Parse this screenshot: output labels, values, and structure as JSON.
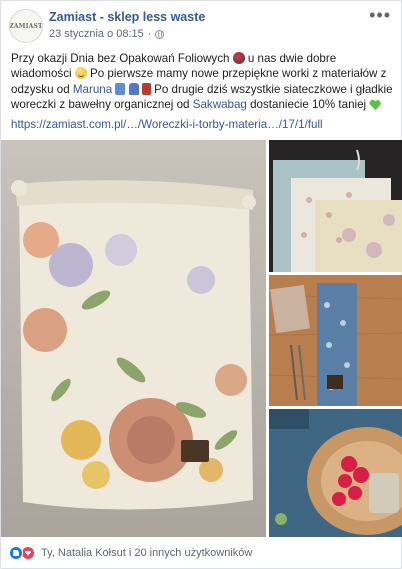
{
  "post": {
    "author": "Zamiast - sklep less waste",
    "avatar_text": "ZAMIAST",
    "date": "23 stycznia o 08:15",
    "separator": "·",
    "more_label": "•••",
    "text_part1": "Przy okazji Dnia bez Opakowań Foliowych ",
    "text_part2": " u nas dwie dobre wiadomości ",
    "text_part3": " Po pierwsze mamy nowe przepiękne worki z materiałów z odzysku od ",
    "tag_maruna": "Maruna",
    "text_part4": " Po drugie dziś wszystkie siateczkowe i gładkie woreczki z bawełny organicznej od ",
    "tag_sakwabag": "Sakwabag",
    "text_part5": " dostaniecie 10% taniej ",
    "link": "https://zamiast.com.pl/…/Woreczki-i-torby-materia…/17/1/full"
  },
  "icons": {
    "globe": "globe-icon",
    "more": "more-options-icon",
    "like": "like-reaction-icon",
    "love": "love-reaction-icon"
  },
  "reactions": {
    "text": "Ty, Natalia Kołsut i 20 innych użytkowników"
  },
  "colors": {
    "link": "#365899",
    "meta": "#616770",
    "like": "#1877f2",
    "love": "#f33e58"
  }
}
